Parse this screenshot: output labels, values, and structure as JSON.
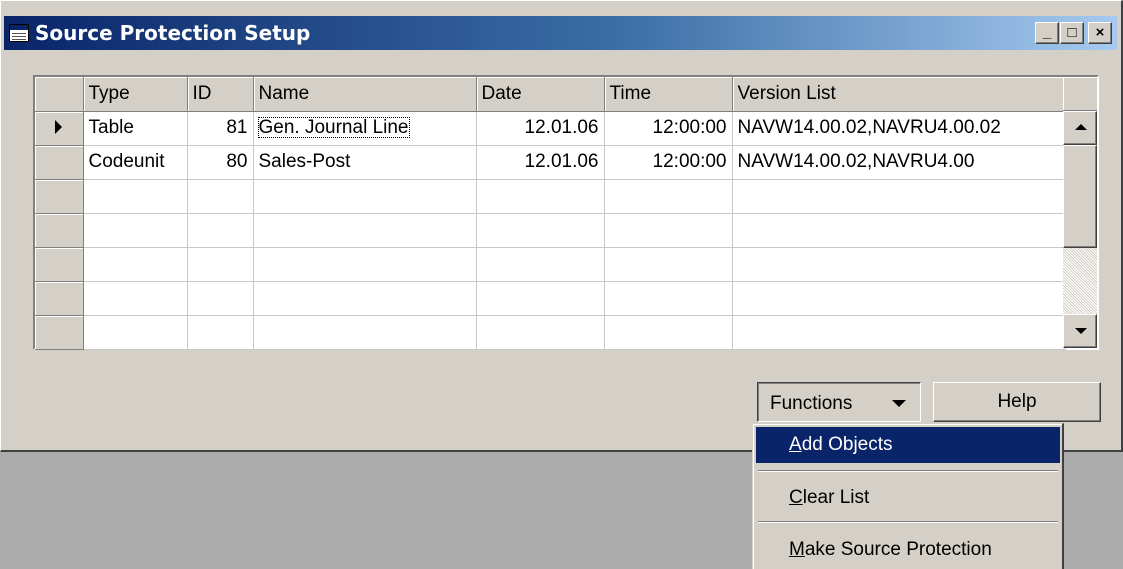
{
  "window": {
    "title": "Source Protection Setup",
    "minimize": "_",
    "maximize": "□",
    "close": "×"
  },
  "grid": {
    "columns": [
      "Type",
      "ID",
      "Name",
      "Date",
      "Time",
      "Version List"
    ],
    "rows": [
      {
        "type": "Table",
        "id": "81",
        "name": "Gen. Journal Line",
        "date": "12.01.06",
        "time": "12:00:00",
        "version": "NAVW14.00.02,NAVRU4.00.02"
      },
      {
        "type": "Codeunit",
        "id": "80",
        "name": "Sales-Post",
        "date": "12.01.06",
        "time": "12:00:00",
        "version": "NAVW14.00.02,NAVRU4.00"
      }
    ]
  },
  "buttons": {
    "functions": "Functions",
    "help": "Help"
  },
  "menu": {
    "add_objects_key": "A",
    "add_objects_rest": "dd Objects",
    "clear_list_key": "C",
    "clear_list_rest": "lear List",
    "make_source_key": "M",
    "make_source_rest": "ake Source Protection"
  },
  "colors": {
    "titlebar_start": "#0a246a",
    "titlebar_end": "#a6caf0",
    "face": "#d4d0c8",
    "highlight": "#0a246a"
  }
}
